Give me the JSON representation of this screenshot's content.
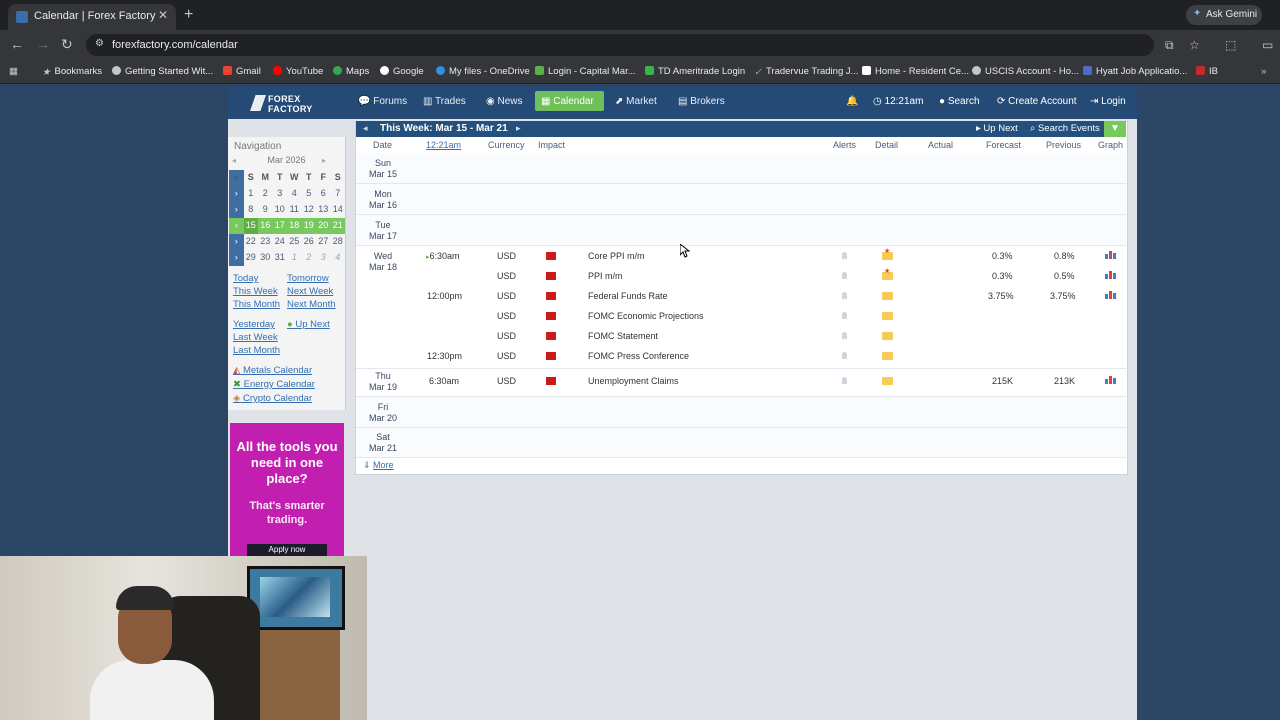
{
  "browser": {
    "tab_title": "Calendar | Forex Factory",
    "url": "forexfactory.com/calendar",
    "ask_gemini": "Ask Gemini",
    "bookmarks": [
      "Bookmarks",
      "Getting Started Wit...",
      "Gmail",
      "YouTube",
      "Maps",
      "Google",
      "My files - OneDrive",
      "Login - Capital Mar...",
      "TD Ameritrade Login",
      "Tradervue Trading J...",
      "Home - Resident Ce...",
      "USCIS Account - Ho...",
      "Hyatt Job Applicatio...",
      "IB"
    ]
  },
  "site": {
    "logo_line1": "FOREX",
    "logo_line2": "FACTORY",
    "nav": [
      "Forums",
      "Trades",
      "News",
      "Calendar",
      "Market",
      "Brokers"
    ],
    "time": "12:21am",
    "search": "Search",
    "create_account": "Create Account",
    "login": "Login"
  },
  "left": {
    "title": "Navigation",
    "month": "Mar 2026",
    "weekdays": [
      "S",
      "M",
      "T",
      "W",
      "T",
      "F",
      "S"
    ],
    "weeks": [
      [
        "1",
        "2",
        "3",
        "4",
        "5",
        "6",
        "7"
      ],
      [
        "8",
        "9",
        "10",
        "11",
        "12",
        "13",
        "14"
      ],
      [
        "15",
        "16",
        "17",
        "18",
        "19",
        "20",
        "21"
      ],
      [
        "22",
        "23",
        "24",
        "25",
        "26",
        "27",
        "28"
      ],
      [
        "29",
        "30",
        "31",
        "1",
        "2",
        "3",
        "4"
      ]
    ],
    "links": {
      "today": "Today",
      "tomorrow": "Tomorrow",
      "this_week": "This Week",
      "next_week": "Next Week",
      "this_month": "This Month",
      "next_month": "Next Month",
      "yesterday": "Yesterday",
      "up_next": "Up Next",
      "last_week": "Last Week",
      "last_month": "Last Month",
      "metals": "Metals Calendar",
      "energy": "Energy Calendar",
      "crypto": "Crypto Calendar"
    },
    "ad": {
      "headline": "All the tools you need in one place?",
      "sub": "That's smarter trading.",
      "button": "Apply now"
    }
  },
  "calendar": {
    "week_label": "This Week: Mar 15 - Mar 21",
    "up_next": "Up Next",
    "search_events": "Search Events",
    "columns": {
      "date": "Date",
      "time": "12:21am",
      "currency": "Currency",
      "impact": "Impact",
      "alerts": "Alerts",
      "detail": "Detail",
      "actual": "Actual",
      "forecast": "Forecast",
      "previous": "Previous",
      "graph": "Graph"
    },
    "days": [
      {
        "dow": "Sun",
        "date": "Mar 15"
      },
      {
        "dow": "Mon",
        "date": "Mar 16"
      },
      {
        "dow": "Tue",
        "date": "Mar 17"
      },
      {
        "dow": "Wed",
        "date": "Mar 18"
      },
      {
        "dow": "Thu",
        "date": "Mar 19"
      },
      {
        "dow": "Fri",
        "date": "Mar 20"
      },
      {
        "dow": "Sat",
        "date": "Mar 21"
      }
    ],
    "events": [
      {
        "time": "6:30am",
        "currency": "USD",
        "title": "Core PPI m/m",
        "forecast": "0.3%",
        "previous": "0.8%"
      },
      {
        "time": "",
        "currency": "USD",
        "title": "PPI m/m",
        "forecast": "0.3%",
        "previous": "0.5%"
      },
      {
        "time": "12:00pm",
        "currency": "USD",
        "title": "Federal Funds Rate",
        "forecast": "3.75%",
        "previous": "3.75%"
      },
      {
        "time": "",
        "currency": "USD",
        "title": "FOMC Economic Projections",
        "forecast": "",
        "previous": ""
      },
      {
        "time": "",
        "currency": "USD",
        "title": "FOMC Statement",
        "forecast": "",
        "previous": ""
      },
      {
        "time": "12:30pm",
        "currency": "USD",
        "title": "FOMC Press Conference",
        "forecast": "",
        "previous": ""
      },
      {
        "time": "6:30am",
        "currency": "USD",
        "title": "Unemployment Claims",
        "forecast": "215K",
        "previous": "213K"
      }
    ],
    "more": "More"
  }
}
